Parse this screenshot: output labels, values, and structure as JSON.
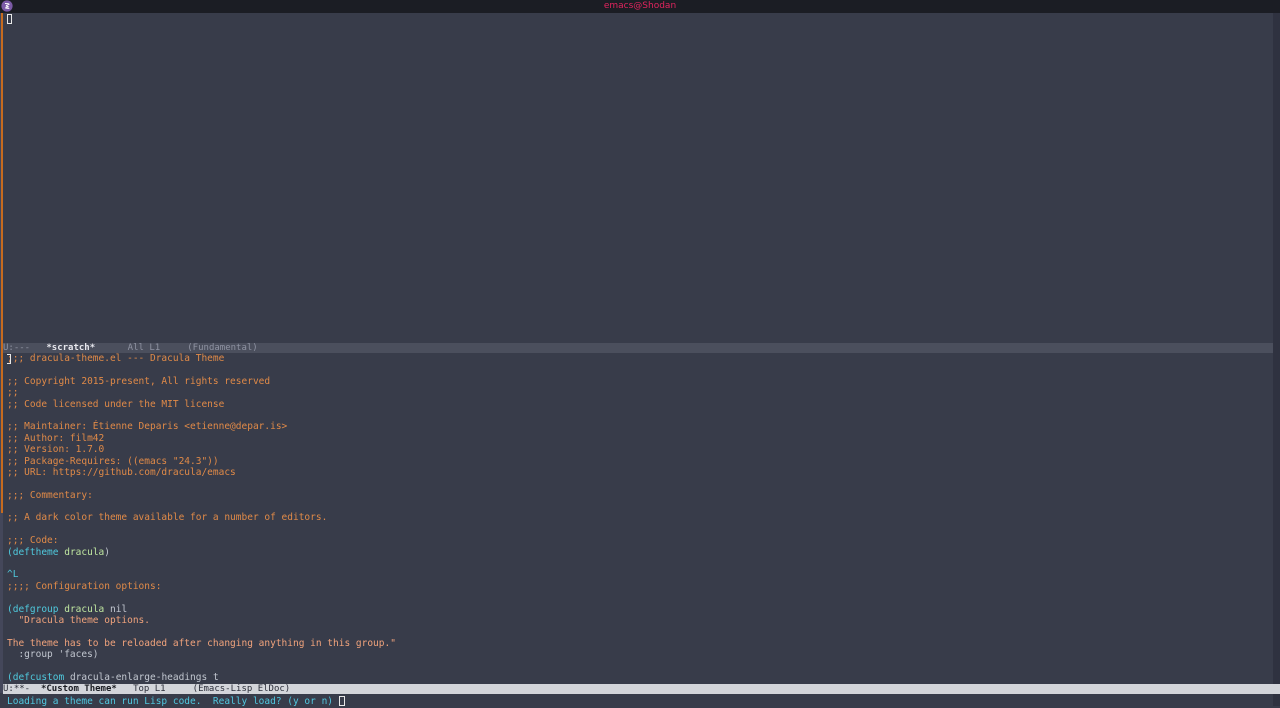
{
  "window": {
    "title": "emacs@Shodan",
    "icon": "emacs-icon"
  },
  "upper_modeline": {
    "state": "U:---",
    "buffer": "*scratch*",
    "position": "All L1",
    "mode": "(Fundamental)"
  },
  "lower_modeline": {
    "state": "U:**-",
    "buffer": "*Custom Theme*",
    "position": "Top L1",
    "mode": "(Emacs-Lisp ElDoc)"
  },
  "colors": {
    "background": "#383c4a",
    "comment": "#e08a48",
    "keyword": "#4fc9dd",
    "function_name": "#bfe6a0",
    "title": "#e0245e"
  },
  "editor": {
    "lines": [
      {
        "text": ";;; dracula-theme.el --- Dracula Theme",
        "cls": "cmt"
      },
      {
        "text": "",
        "cls": ""
      },
      {
        "text": ";; Copyright 2015-present, All rights reserved",
        "cls": "cmt"
      },
      {
        "text": ";;",
        "cls": "cmt"
      },
      {
        "text": ";; Code licensed under the MIT license",
        "cls": "cmt"
      },
      {
        "text": "",
        "cls": ""
      },
      {
        "text": ";; Maintainer: Étienne Deparis <etienne@depar.is>",
        "cls": "cmt"
      },
      {
        "text": ";; Author: film42",
        "cls": "cmt"
      },
      {
        "text": ";; Version: 1.7.0",
        "cls": "cmt"
      },
      {
        "text": ";; Package-Requires: ((emacs \"24.3\"))",
        "cls": "cmt"
      },
      {
        "text": ";; URL: https://github.com/dracula/emacs",
        "cls": "cmt"
      },
      {
        "text": "",
        "cls": ""
      },
      {
        "text": ";;; Commentary:",
        "cls": "cmt"
      },
      {
        "text": "",
        "cls": ""
      },
      {
        "text": ";; A dark color theme available for a number of editors.",
        "cls": "cmt"
      },
      {
        "text": "",
        "cls": ""
      },
      {
        "text": ";;; Code:",
        "cls": "cmt"
      },
      {
        "segments": [
          {
            "text": "(",
            "cls": "kw"
          },
          {
            "text": "deftheme",
            "cls": "kw"
          },
          {
            "text": " ",
            "cls": ""
          },
          {
            "text": "dracula",
            "cls": "name"
          },
          {
            "text": ")",
            "cls": ""
          }
        ]
      },
      {
        "text": "",
        "cls": ""
      },
      {
        "text": "^L",
        "cls": "kw"
      },
      {
        "text": ";;;; Configuration options:",
        "cls": "cmt"
      },
      {
        "text": "",
        "cls": ""
      },
      {
        "segments": [
          {
            "text": "(",
            "cls": "kw"
          },
          {
            "text": "defgroup",
            "cls": "kw"
          },
          {
            "text": " ",
            "cls": ""
          },
          {
            "text": "dracula",
            "cls": "name"
          },
          {
            "text": " nil",
            "cls": ""
          }
        ]
      },
      {
        "text": "  \"Dracula theme options.",
        "cls": "str"
      },
      {
        "text": "",
        "cls": ""
      },
      {
        "text": "The theme has to be reloaded after changing anything in this group.\"",
        "cls": "str"
      },
      {
        "text": "  :group 'faces)",
        "cls": ""
      },
      {
        "text": "",
        "cls": ""
      },
      {
        "segments": [
          {
            "text": "(",
            "cls": "kw"
          },
          {
            "text": "defcustom",
            "cls": "kw"
          },
          {
            "text": " ",
            "cls": ""
          },
          {
            "text": "dracula-enlarge-headings",
            "cls": ""
          },
          {
            "text": " t",
            "cls": ""
          }
        ]
      }
    ]
  },
  "minibuffer": {
    "prompt": "Loading a theme can run Lisp code.  Really load? (y or n) "
  }
}
